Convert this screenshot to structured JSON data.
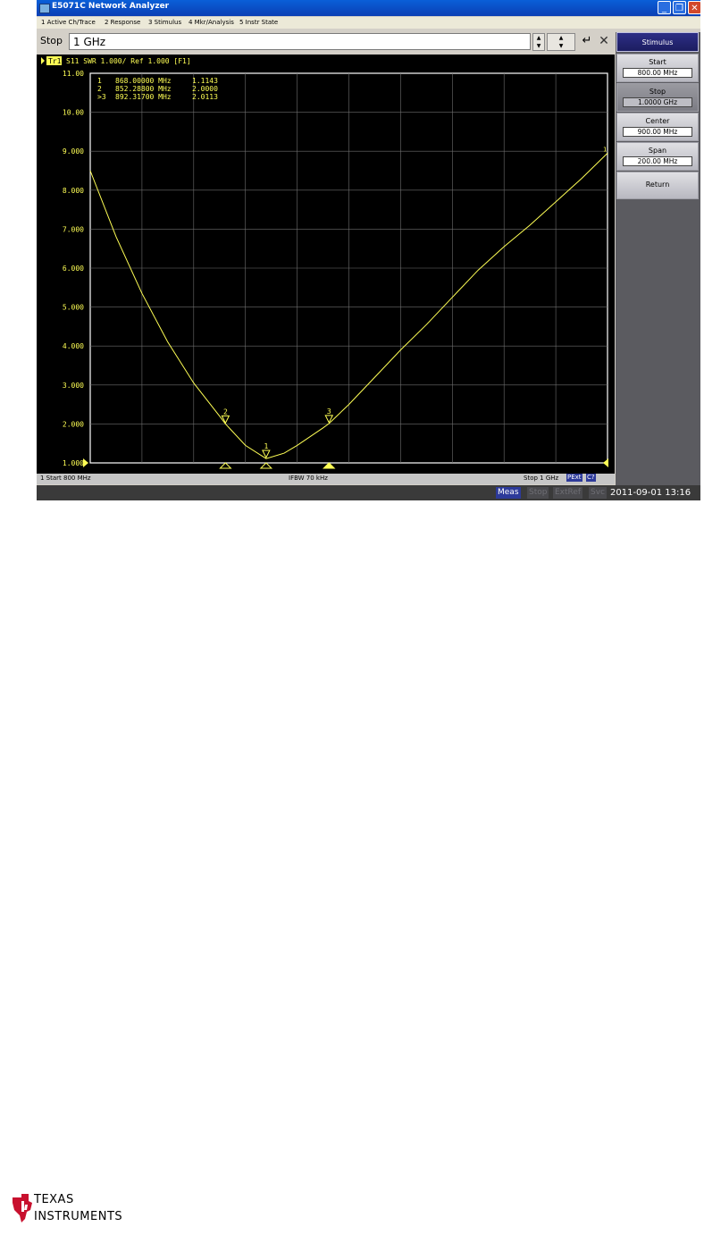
{
  "window": {
    "title": "E5071C Network Analyzer",
    "menu": [
      "1 Active Ch/Trace",
      "2 Response",
      "3 Stimulus",
      "4 Mkr/Analysis",
      "5 Instr State"
    ]
  },
  "entry": {
    "label": "Stop",
    "value": "1 GHz",
    "enter_glyph": "↵",
    "cancel_glyph": "✕"
  },
  "softkeys": {
    "header": "Stimulus",
    "items": [
      {
        "label": "Start",
        "value": "800.00 MHz"
      },
      {
        "label": "Stop",
        "value": "1.0000 GHz"
      },
      {
        "label": "Center",
        "value": "900.00 MHz"
      },
      {
        "label": "Span",
        "value": "200.00 MHz"
      }
    ],
    "return_label": "Return"
  },
  "trace": {
    "tag": "Tr1",
    "header": "S11  SWR 1.000/ Ref 1.000 [F1]",
    "color": "#ffff55"
  },
  "markers": [
    {
      "row": " 1",
      "freq": "868.00000 MHz",
      "value": "1.1143"
    },
    {
      "row": " 2",
      "freq": "852.28800 MHz",
      "value": "2.0000"
    },
    {
      "row": ">3",
      "freq": "892.31700 MHz",
      "value": "2.0113"
    }
  ],
  "status": {
    "start": "1  Start 800 MHz",
    "ifbw": "IFBW 70 kHz",
    "stop": "Stop 1 GHz",
    "badges": [
      "PExt",
      "C?"
    ]
  },
  "bottom": {
    "items": [
      "Meas",
      "Stop",
      "ExtRef",
      "Svc"
    ],
    "datetime": "2011-09-01 13:16"
  },
  "brand": {
    "line1": "TEXAS",
    "line2": "INSTRUMENTS"
  },
  "chart_data": {
    "type": "line",
    "title": "S11  SWR 1.000/ Ref 1.000 [F1]",
    "xlabel": "",
    "ylabel": "",
    "xlim": [
      800,
      1000
    ],
    "ylim": [
      1,
      11
    ],
    "y_ticks": [
      "11.00",
      "10.00",
      "9.000",
      "8.000",
      "7.000",
      "6.000",
      "5.000",
      "4.000",
      "3.000",
      "2.000",
      "1.000"
    ],
    "grid": true,
    "series": [
      {
        "x": [
          800,
          810,
          820,
          830,
          840,
          850,
          852.3,
          860,
          868,
          875,
          880,
          890,
          892.3,
          900,
          910,
          920,
          930,
          940,
          950,
          960,
          970,
          980,
          990,
          1000
        ],
        "y": [
          8.5,
          6.8,
          5.35,
          4.1,
          3.05,
          2.2,
          2.0,
          1.45,
          1.11,
          1.25,
          1.45,
          1.9,
          2.01,
          2.5,
          3.2,
          3.9,
          4.55,
          5.25,
          5.95,
          6.55,
          7.1,
          7.7,
          8.3,
          8.95
        ]
      }
    ],
    "markers": [
      {
        "id": "1",
        "x": 868.0,
        "y": 1.1143
      },
      {
        "id": "2",
        "x": 852.288,
        "y": 2.0
      },
      {
        "id": "3",
        "x": 892.317,
        "y": 2.0113
      }
    ]
  }
}
